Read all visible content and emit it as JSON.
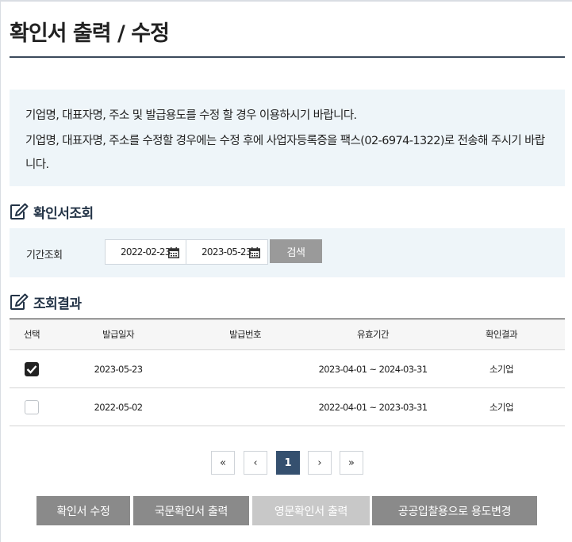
{
  "page": {
    "title": "확인서 출력 / 수정"
  },
  "notice": {
    "line1": "기업명, 대표자명, 주소 및 발급용도를 수정 할 경우 이용하시기 바랍니다.",
    "line2": "기업명, 대표자명, 주소를 수정할 경우에는 수정 후에 사업자등록증을 팩스(02-6974-1322)로 전송해 주시기 바랍니다."
  },
  "search_section": {
    "title": "확인서조회",
    "icon": "edit-icon",
    "period_label": "기간조회",
    "start_date": "2022-02-23",
    "end_date": "2023-05-23",
    "calendar_icon": "calendar-icon",
    "search_button": "검색"
  },
  "results_section": {
    "title": "조회결과",
    "icon": "edit-icon",
    "columns": [
      "선택",
      "발급일자",
      "발급번호",
      "유효기간",
      "확인결과"
    ],
    "rows": [
      {
        "checked": true,
        "issue_date": "2023-05-23",
        "issue_no": "",
        "valid_period": "2023-04-01 ~ 2024-03-31",
        "result": "소기업"
      },
      {
        "checked": false,
        "issue_date": "2022-05-02",
        "issue_no": "",
        "valid_period": "2022-04-01 ~ 2023-03-31",
        "result": "소기업"
      }
    ]
  },
  "pagination": {
    "first": "«",
    "prev": "‹",
    "current": "1",
    "next": "›",
    "last": "»"
  },
  "actions": {
    "edit": "확인서 수정",
    "print_korean": "국문확인서 출력",
    "print_english": "영문확인서 출력",
    "change_purpose": "공공입찰용으로 용도변경"
  },
  "colors": {
    "accent": "#35506f",
    "panel": "#eef5f9",
    "button": "#8a8a8a",
    "button_disabled": "#c8c8c8"
  }
}
